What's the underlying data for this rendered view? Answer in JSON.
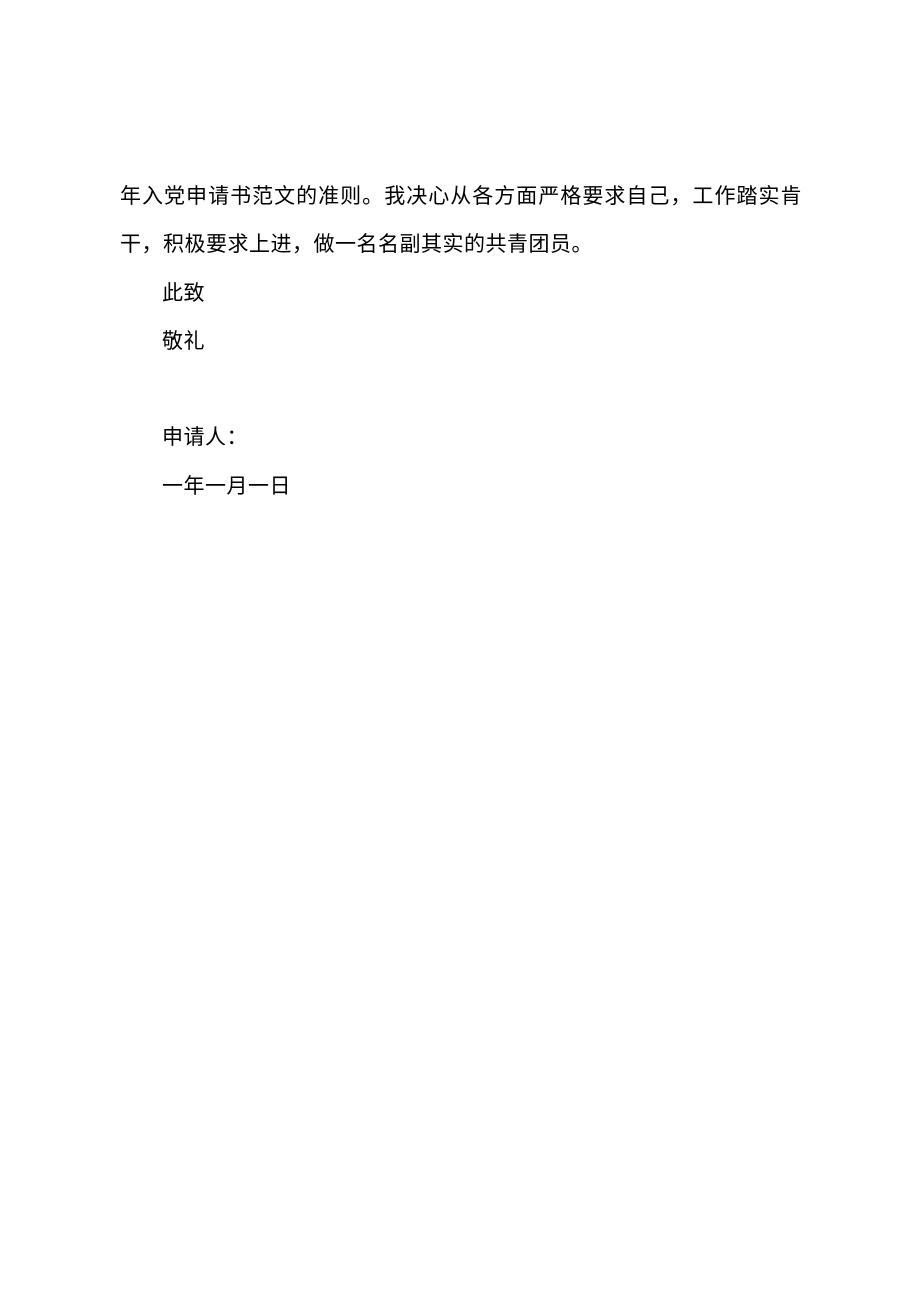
{
  "document": {
    "paragraph_continue": "年入党申请书范文的准则。我决心从各方面严格要求自己，工作踏实肯干，积极要求上进，做一名名副其实的共青团员。",
    "closing1": "此致",
    "closing2": "敬礼",
    "applicant_label": "申请人：",
    "date": "一年一月一日"
  }
}
